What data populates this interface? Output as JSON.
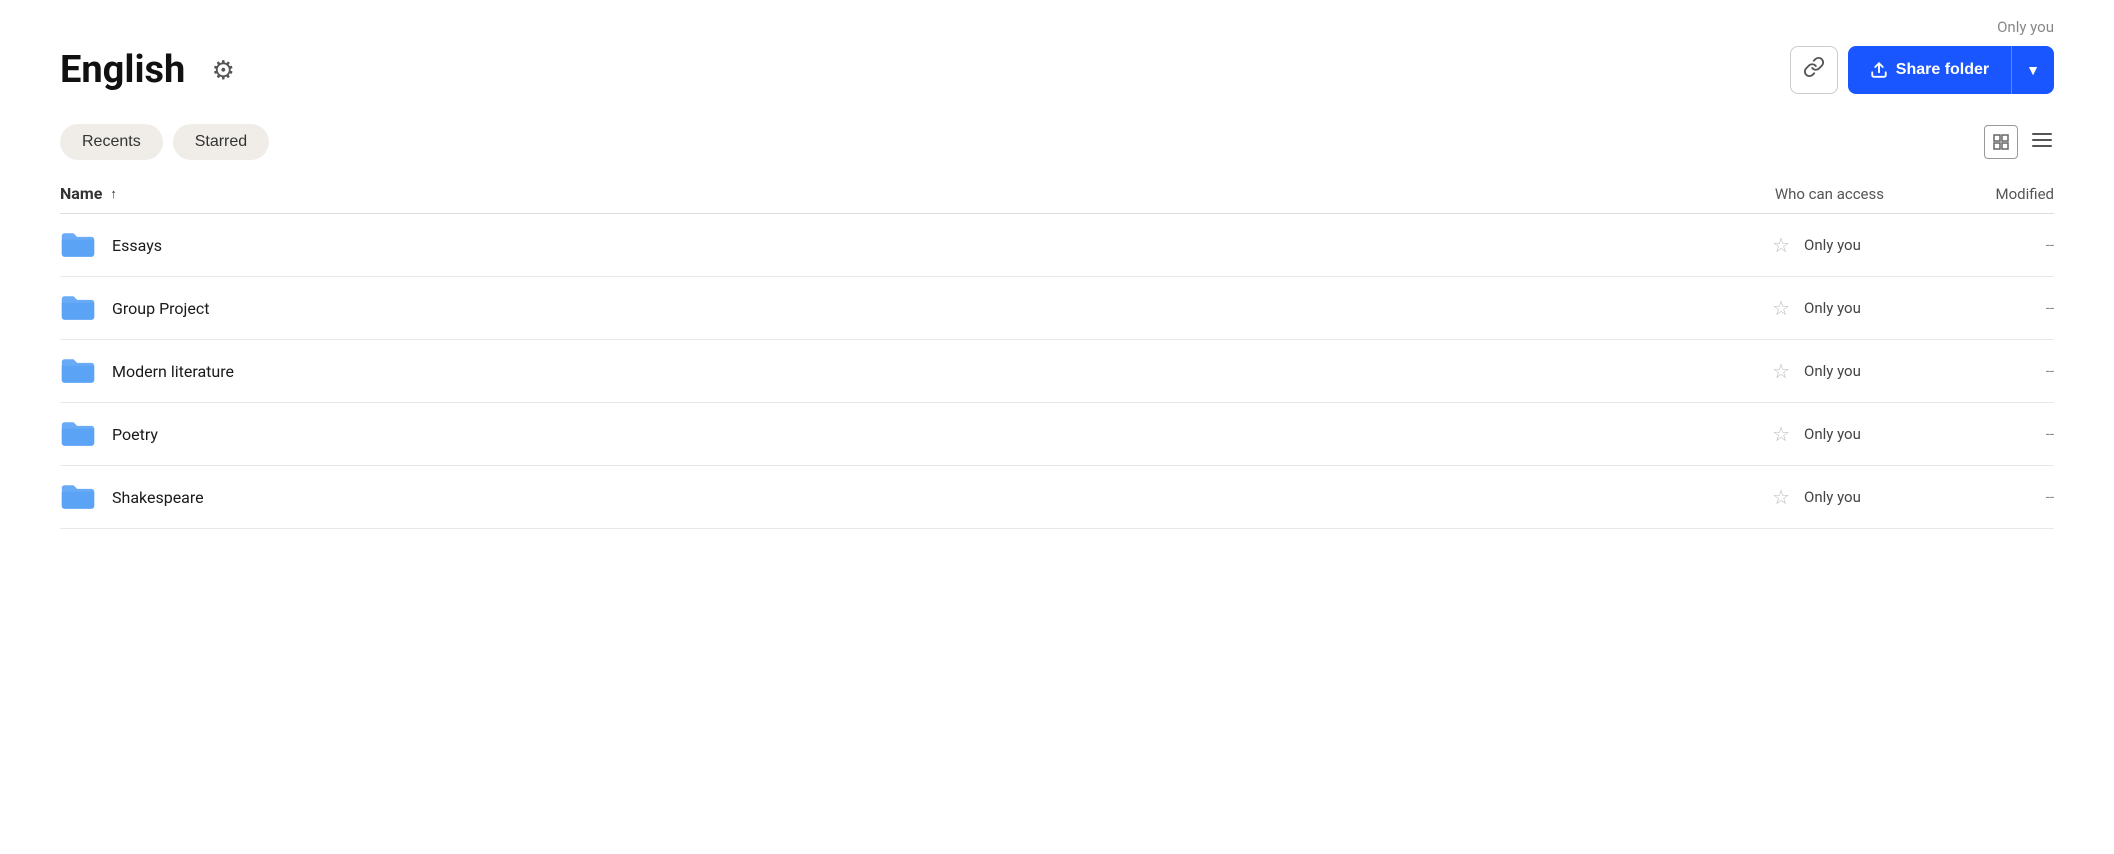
{
  "header": {
    "title": "English",
    "access_label": "Only you",
    "gear_icon": "⚙",
    "link_icon": "🔗",
    "share_label": "Share folder",
    "share_arrow": "▼"
  },
  "filters": {
    "recents_label": "Recents",
    "starred_label": "Starred"
  },
  "table": {
    "col_name": "Name",
    "col_access": "Who can access",
    "col_modified": "Modified"
  },
  "files": [
    {
      "name": "Essays",
      "access": "Only you",
      "modified": "--"
    },
    {
      "name": "Group Project",
      "access": "Only you",
      "modified": "--"
    },
    {
      "name": "Modern literature",
      "access": "Only you",
      "modified": "--"
    },
    {
      "name": "Poetry",
      "access": "Only you",
      "modified": "--"
    },
    {
      "name": "Shakespeare",
      "access": "Only you",
      "modified": "--"
    }
  ]
}
